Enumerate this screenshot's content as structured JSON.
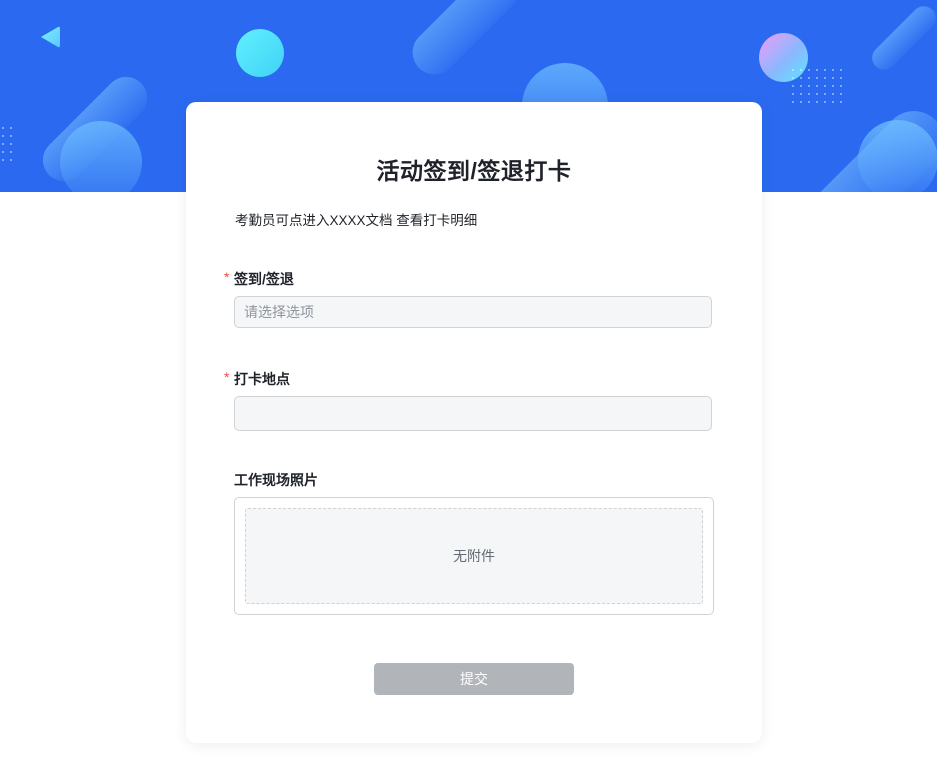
{
  "form": {
    "title": "活动签到/签退打卡",
    "description": "考勤员可点进入XXXX文档 查看打卡明细",
    "fields": [
      {
        "label": "签到/签退",
        "required": true,
        "required_mark": "*",
        "placeholder": "请选择选项",
        "value": ""
      },
      {
        "label": "打卡地点",
        "required": true,
        "required_mark": "*",
        "placeholder": "",
        "value": ""
      },
      {
        "label": "工作现场照片",
        "required": false,
        "attachment_text": "无附件"
      }
    ],
    "submit_label": "提交"
  },
  "colors": {
    "banner": "#2b6af0",
    "required": "#f54a45",
    "submit_disabled": "#b1b5ba"
  }
}
